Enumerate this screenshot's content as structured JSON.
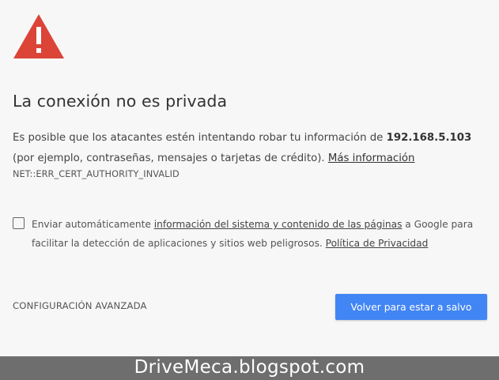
{
  "interstitial": {
    "title": "La conexión no es privada",
    "description_pre": "Es posible que los atacantes estén intentando robar tu información de ",
    "host": "192.168.5.103",
    "description_post": "(por ejemplo, contraseñas, mensajes o tarjetas de crédito). ",
    "more_info_link": "Más información",
    "error_code": "NET::ERR_CERT_AUTHORITY_INVALID",
    "optin": {
      "checked": false,
      "text_pre": "Enviar automáticamente ",
      "link_system_info": "información del sistema y contenido de las páginas",
      "text_mid": " a Google para facilitar la detección de aplicaciones y sitios web peligrosos. ",
      "link_privacy": "Política de Privacidad"
    },
    "advanced_button": "CONFIGURACIÓN AVANZADA",
    "primary_button": "Volver para estar a salvo",
    "icon": "warning-triangle-icon"
  },
  "colors": {
    "warning_red": "#db4437",
    "primary_blue": "#4285f4",
    "background": "#f7f7f7"
  },
  "watermark": {
    "text": "DriveMeca.blogspot.com"
  }
}
